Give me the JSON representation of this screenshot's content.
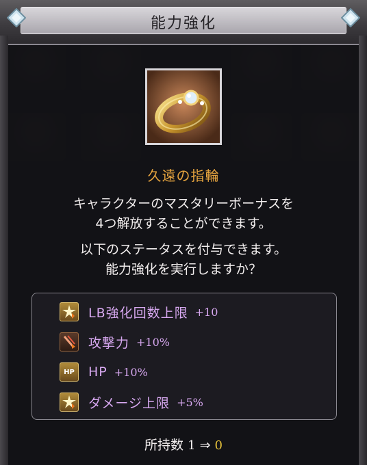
{
  "dialog": {
    "title": "能力強化",
    "item_name": "久遠の指輪",
    "description_line1": "キャラクターのマスタリーボーナスを",
    "description_line2": "4つ解放することができます。",
    "confirm_line1": "以下のステータスを付与できます。",
    "confirm_line2": "能力強化を実行しますか？"
  },
  "effects": [
    {
      "icon": "star-burst-icon",
      "label": "LB強化回数上限",
      "value": "+10"
    },
    {
      "icon": "sword-attack-icon",
      "label": "攻撃力",
      "value": "+10%"
    },
    {
      "icon": "hp-icon",
      "label": "HP",
      "value": "+10%"
    },
    {
      "icon": "star-burst-icon",
      "label": "ダメージ上限",
      "value": "+5%"
    }
  ],
  "owned": {
    "label": "所持数",
    "before": "1",
    "arrow": "⇒",
    "after": "0"
  },
  "hp_badge": "HP",
  "colors": {
    "item_name": "#e6a43f",
    "effect_text": "#d7a8f0",
    "after_count": "#e6c23a"
  }
}
